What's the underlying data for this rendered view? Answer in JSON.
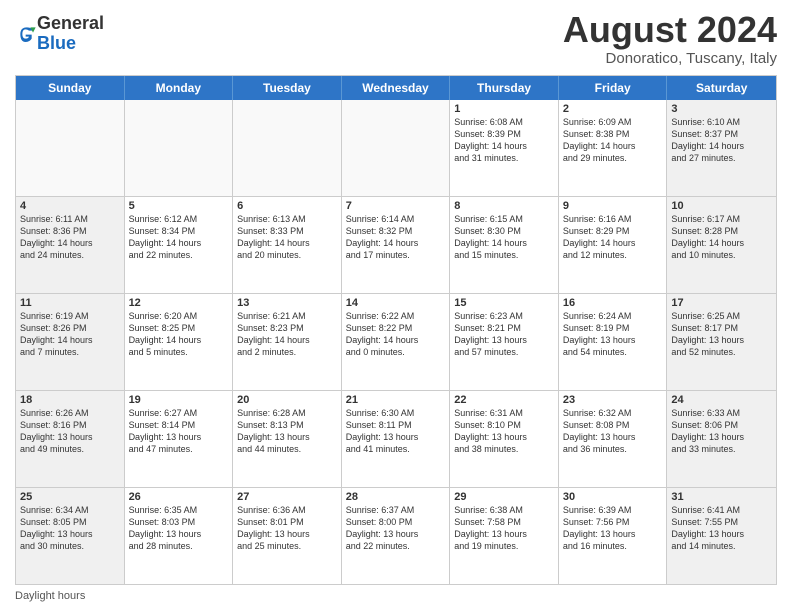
{
  "logo": {
    "general": "General",
    "blue": "Blue"
  },
  "title": "August 2024",
  "subtitle": "Donoratico, Tuscany, Italy",
  "days_of_week": [
    "Sunday",
    "Monday",
    "Tuesday",
    "Wednesday",
    "Thursday",
    "Friday",
    "Saturday"
  ],
  "footer_label": "Daylight hours",
  "weeks": [
    [
      {
        "num": "",
        "info": "",
        "empty": true
      },
      {
        "num": "",
        "info": "",
        "empty": true
      },
      {
        "num": "",
        "info": "",
        "empty": true
      },
      {
        "num": "",
        "info": "",
        "empty": true
      },
      {
        "num": "1",
        "info": "Sunrise: 6:08 AM\nSunset: 8:39 PM\nDaylight: 14 hours\nand 31 minutes.",
        "empty": false
      },
      {
        "num": "2",
        "info": "Sunrise: 6:09 AM\nSunset: 8:38 PM\nDaylight: 14 hours\nand 29 minutes.",
        "empty": false
      },
      {
        "num": "3",
        "info": "Sunrise: 6:10 AM\nSunset: 8:37 PM\nDaylight: 14 hours\nand 27 minutes.",
        "empty": false,
        "shaded": true
      }
    ],
    [
      {
        "num": "4",
        "info": "Sunrise: 6:11 AM\nSunset: 8:36 PM\nDaylight: 14 hours\nand 24 minutes.",
        "empty": false,
        "shaded": true
      },
      {
        "num": "5",
        "info": "Sunrise: 6:12 AM\nSunset: 8:34 PM\nDaylight: 14 hours\nand 22 minutes.",
        "empty": false
      },
      {
        "num": "6",
        "info": "Sunrise: 6:13 AM\nSunset: 8:33 PM\nDaylight: 14 hours\nand 20 minutes.",
        "empty": false
      },
      {
        "num": "7",
        "info": "Sunrise: 6:14 AM\nSunset: 8:32 PM\nDaylight: 14 hours\nand 17 minutes.",
        "empty": false
      },
      {
        "num": "8",
        "info": "Sunrise: 6:15 AM\nSunset: 8:30 PM\nDaylight: 14 hours\nand 15 minutes.",
        "empty": false
      },
      {
        "num": "9",
        "info": "Sunrise: 6:16 AM\nSunset: 8:29 PM\nDaylight: 14 hours\nand 12 minutes.",
        "empty": false
      },
      {
        "num": "10",
        "info": "Sunrise: 6:17 AM\nSunset: 8:28 PM\nDaylight: 14 hours\nand 10 minutes.",
        "empty": false,
        "shaded": true
      }
    ],
    [
      {
        "num": "11",
        "info": "Sunrise: 6:19 AM\nSunset: 8:26 PM\nDaylight: 14 hours\nand 7 minutes.",
        "empty": false,
        "shaded": true
      },
      {
        "num": "12",
        "info": "Sunrise: 6:20 AM\nSunset: 8:25 PM\nDaylight: 14 hours\nand 5 minutes.",
        "empty": false
      },
      {
        "num": "13",
        "info": "Sunrise: 6:21 AM\nSunset: 8:23 PM\nDaylight: 14 hours\nand 2 minutes.",
        "empty": false
      },
      {
        "num": "14",
        "info": "Sunrise: 6:22 AM\nSunset: 8:22 PM\nDaylight: 14 hours\nand 0 minutes.",
        "empty": false
      },
      {
        "num": "15",
        "info": "Sunrise: 6:23 AM\nSunset: 8:21 PM\nDaylight: 13 hours\nand 57 minutes.",
        "empty": false
      },
      {
        "num": "16",
        "info": "Sunrise: 6:24 AM\nSunset: 8:19 PM\nDaylight: 13 hours\nand 54 minutes.",
        "empty": false
      },
      {
        "num": "17",
        "info": "Sunrise: 6:25 AM\nSunset: 8:17 PM\nDaylight: 13 hours\nand 52 minutes.",
        "empty": false,
        "shaded": true
      }
    ],
    [
      {
        "num": "18",
        "info": "Sunrise: 6:26 AM\nSunset: 8:16 PM\nDaylight: 13 hours\nand 49 minutes.",
        "empty": false,
        "shaded": true
      },
      {
        "num": "19",
        "info": "Sunrise: 6:27 AM\nSunset: 8:14 PM\nDaylight: 13 hours\nand 47 minutes.",
        "empty": false
      },
      {
        "num": "20",
        "info": "Sunrise: 6:28 AM\nSunset: 8:13 PM\nDaylight: 13 hours\nand 44 minutes.",
        "empty": false
      },
      {
        "num": "21",
        "info": "Sunrise: 6:30 AM\nSunset: 8:11 PM\nDaylight: 13 hours\nand 41 minutes.",
        "empty": false
      },
      {
        "num": "22",
        "info": "Sunrise: 6:31 AM\nSunset: 8:10 PM\nDaylight: 13 hours\nand 38 minutes.",
        "empty": false
      },
      {
        "num": "23",
        "info": "Sunrise: 6:32 AM\nSunset: 8:08 PM\nDaylight: 13 hours\nand 36 minutes.",
        "empty": false
      },
      {
        "num": "24",
        "info": "Sunrise: 6:33 AM\nSunset: 8:06 PM\nDaylight: 13 hours\nand 33 minutes.",
        "empty": false,
        "shaded": true
      }
    ],
    [
      {
        "num": "25",
        "info": "Sunrise: 6:34 AM\nSunset: 8:05 PM\nDaylight: 13 hours\nand 30 minutes.",
        "empty": false,
        "shaded": true
      },
      {
        "num": "26",
        "info": "Sunrise: 6:35 AM\nSunset: 8:03 PM\nDaylight: 13 hours\nand 28 minutes.",
        "empty": false
      },
      {
        "num": "27",
        "info": "Sunrise: 6:36 AM\nSunset: 8:01 PM\nDaylight: 13 hours\nand 25 minutes.",
        "empty": false
      },
      {
        "num": "28",
        "info": "Sunrise: 6:37 AM\nSunset: 8:00 PM\nDaylight: 13 hours\nand 22 minutes.",
        "empty": false
      },
      {
        "num": "29",
        "info": "Sunrise: 6:38 AM\nSunset: 7:58 PM\nDaylight: 13 hours\nand 19 minutes.",
        "empty": false
      },
      {
        "num": "30",
        "info": "Sunrise: 6:39 AM\nSunset: 7:56 PM\nDaylight: 13 hours\nand 16 minutes.",
        "empty": false
      },
      {
        "num": "31",
        "info": "Sunrise: 6:41 AM\nSunset: 7:55 PM\nDaylight: 13 hours\nand 14 minutes.",
        "empty": false,
        "shaded": true
      }
    ]
  ]
}
